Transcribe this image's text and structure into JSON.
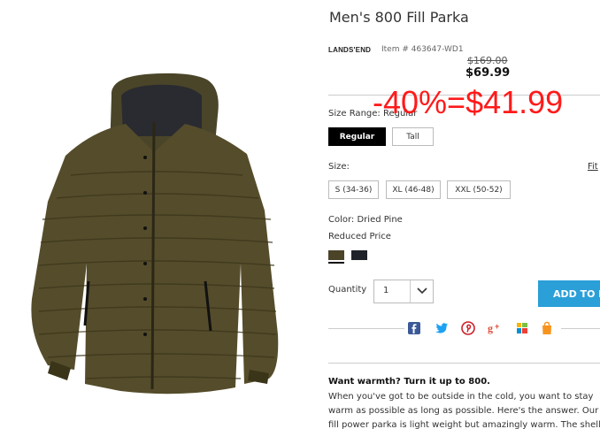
{
  "product": {
    "title": "Men's 800 Fill Parka",
    "brand": "LANDS'END",
    "item_number": "Item # 463647-WD1",
    "price_original": "$169.00",
    "price_sale": "$69.99",
    "discount_overlay": "-40%=$41.99"
  },
  "size_range": {
    "label": "Size Range: Regular",
    "options": [
      "Regular",
      "Tall"
    ],
    "selected": "Regular"
  },
  "size": {
    "label": "Size:",
    "fit_link": "Fit",
    "options": [
      "S (34-36)",
      "XL (46-48)",
      "XXL (50-52)"
    ]
  },
  "color": {
    "label": "Color: Dried Pine",
    "status": "Reduced Price",
    "swatches": [
      "Dried Pine",
      "Navy"
    ],
    "swatch_colors": [
      "#4b4428",
      "#1f2229"
    ]
  },
  "quantity": {
    "label": "Quantity",
    "value": "1"
  },
  "cart": {
    "add_label": "ADD TO B"
  },
  "share": {
    "icons": [
      "facebook-icon",
      "twitter-icon",
      "pinterest-icon",
      "google-plus-icon",
      "social-icon",
      "shopping-bag-icon"
    ]
  },
  "description": {
    "heading": "Want warmth? Turn it up to 800.",
    "lines": [
      "When you've got to be outside in the cold, you want to stay",
      "warm as possible as long as possible. Here's the answer. Our",
      "fill power parka is light weight but amazingly warm. The shell"
    ]
  },
  "colors": {
    "accent": "#2a9fd8",
    "discount": "#ff1a1a"
  }
}
